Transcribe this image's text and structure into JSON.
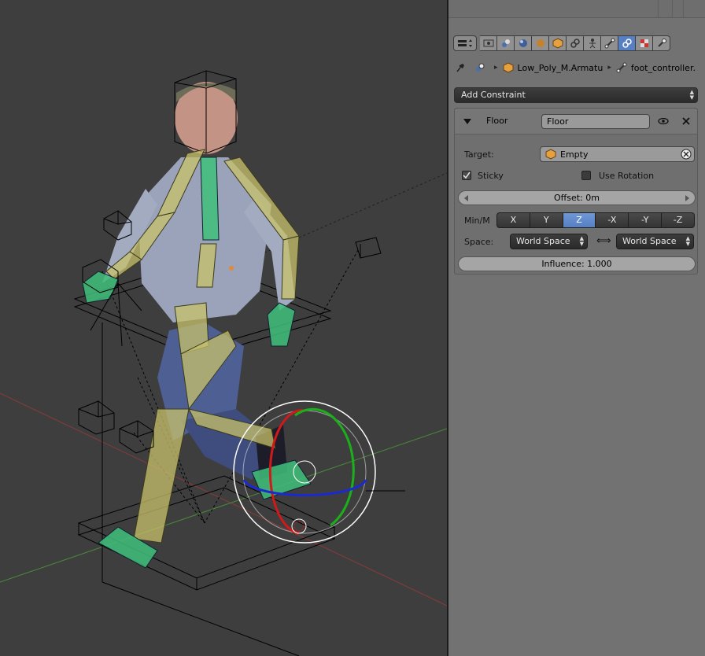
{
  "viewport": {
    "description_icons": [
      "armature-bone",
      "empty-cube",
      "foot-gizmo"
    ]
  },
  "properties": {
    "tabs": [
      {
        "icon": "render-icon",
        "active": false
      },
      {
        "icon": "render-layers-icon",
        "active": false
      },
      {
        "icon": "scene-icon",
        "active": false
      },
      {
        "icon": "world-icon",
        "active": false
      },
      {
        "icon": "object-icon",
        "active": false
      },
      {
        "icon": "object-constraint-icon",
        "active": false
      },
      {
        "icon": "armature-data-icon",
        "active": false
      },
      {
        "icon": "bone-icon",
        "active": false
      },
      {
        "icon": "bone-constraint-icon",
        "active": true
      },
      {
        "icon": "texture-icon",
        "active": false
      },
      {
        "icon": "physics-icon",
        "active": false
      }
    ],
    "breadcrumb": {
      "armature": "Low_Poly_M.Armatu",
      "bone": "foot_controller."
    },
    "add_constraint_label": "Add Constraint",
    "constraint": {
      "type_label": "Floor",
      "name_value": "Floor",
      "target_label": "Target:",
      "target_value": "Empty",
      "sticky_label": "Sticky",
      "sticky_checked": true,
      "use_rotation_label": "Use Rotation",
      "use_rotation_checked": false,
      "offset_text": "Offset: 0m",
      "minm_label": "Min/M",
      "axes": [
        "X",
        "Y",
        "Z",
        "-X",
        "-Y",
        "-Z"
      ],
      "active_axis": "Z",
      "space_label": "Space:",
      "owner_space": "World Space",
      "target_space": "World Space",
      "influence_text": "Influence: 1.000"
    },
    "colors": {
      "active_tab": "#5680c2",
      "panel_bg": "#727272",
      "viewport_bg": "#3e3e3e"
    }
  }
}
